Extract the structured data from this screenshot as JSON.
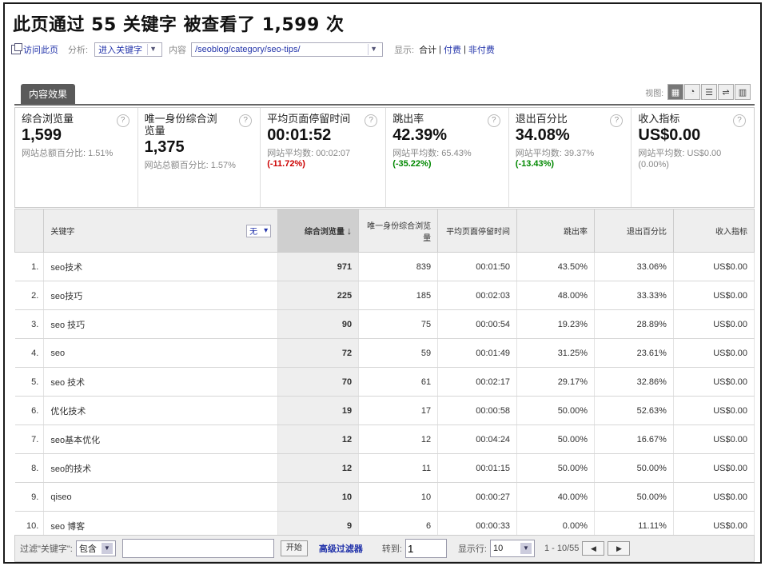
{
  "header": {
    "title": "此页通过 55 关键字 被查看了 1,599 次"
  },
  "toolbar": {
    "visit_page_label": "访问此页",
    "analysis_label": "分析:",
    "analysis_value": "进入关键字",
    "content_label": "内容",
    "content_value": "/seoblog/category/seo-tips/",
    "display_label": "显示:",
    "display_options": [
      "合计",
      "付费",
      "非付费"
    ]
  },
  "tab": {
    "label": "内容效果"
  },
  "views": {
    "label": "视图:",
    "icons": [
      "table-view-icon",
      "pie-view-icon",
      "bar-view-icon",
      "compare-view-icon",
      "pivot-view-icon"
    ]
  },
  "metrics": [
    {
      "label": "综合浏览量",
      "value": "1,599",
      "sub": "网站总额百分比: 1.51%",
      "change": ""
    },
    {
      "label": "唯一身份综合浏览量",
      "value": "1,375",
      "sub": "网站总额百分比: 1.57%",
      "change": ""
    },
    {
      "label": "平均页面停留时间",
      "value": "00:01:52",
      "sub": "网站平均数: 00:02:07",
      "change": "(-11.72%)",
      "change_type": "neg"
    },
    {
      "label": "跳出率",
      "value": "42.39%",
      "sub": "网站平均数: 65.43%",
      "change": "(-35.22%)",
      "change_type": "pos"
    },
    {
      "label": "退出百分比",
      "value": "34.08%",
      "sub": "网站平均数: 39.37%",
      "change": "(-13.43%)",
      "change_type": "pos"
    },
    {
      "label": "收入指标",
      "value": "US$0.00",
      "sub": "网站平均数: US$0.00 (0.00%)",
      "change": ""
    }
  ],
  "table": {
    "headers": {
      "keyword": "关键字",
      "keyword_filter": "无",
      "pageviews": "综合浏览量",
      "unique_pageviews": "唯一身份综合浏览量",
      "avg_time": "平均页面停留时间",
      "bounce_rate": "跳出率",
      "exit_pct": "退出百分比",
      "revenue": "收入指标"
    },
    "rows": [
      {
        "num": "1.",
        "keyword": "seo技术",
        "pageviews": "971",
        "unique": "839",
        "time": "00:01:50",
        "bounce": "43.50%",
        "exit": "33.06%",
        "revenue": "US$0.00"
      },
      {
        "num": "2.",
        "keyword": "seo技巧",
        "pageviews": "225",
        "unique": "185",
        "time": "00:02:03",
        "bounce": "48.00%",
        "exit": "33.33%",
        "revenue": "US$0.00"
      },
      {
        "num": "3.",
        "keyword": "seo 技巧",
        "pageviews": "90",
        "unique": "75",
        "time": "00:00:54",
        "bounce": "19.23%",
        "exit": "28.89%",
        "revenue": "US$0.00"
      },
      {
        "num": "4.",
        "keyword": "seo",
        "pageviews": "72",
        "unique": "59",
        "time": "00:01:49",
        "bounce": "31.25%",
        "exit": "23.61%",
        "revenue": "US$0.00"
      },
      {
        "num": "5.",
        "keyword": "seo 技术",
        "pageviews": "70",
        "unique": "61",
        "time": "00:02:17",
        "bounce": "29.17%",
        "exit": "32.86%",
        "revenue": "US$0.00"
      },
      {
        "num": "6.",
        "keyword": "优化技术",
        "pageviews": "19",
        "unique": "17",
        "time": "00:00:58",
        "bounce": "50.00%",
        "exit": "52.63%",
        "revenue": "US$0.00"
      },
      {
        "num": "7.",
        "keyword": "seo基本优化",
        "pageviews": "12",
        "unique": "12",
        "time": "00:04:24",
        "bounce": "50.00%",
        "exit": "16.67%",
        "revenue": "US$0.00"
      },
      {
        "num": "8.",
        "keyword": "seo的技术",
        "pageviews": "12",
        "unique": "11",
        "time": "00:01:15",
        "bounce": "50.00%",
        "exit": "50.00%",
        "revenue": "US$0.00"
      },
      {
        "num": "9.",
        "keyword": "qiseo",
        "pageviews": "10",
        "unique": "10",
        "time": "00:00:27",
        "bounce": "40.00%",
        "exit": "50.00%",
        "revenue": "US$0.00"
      },
      {
        "num": "10.",
        "keyword": "seo 博客",
        "pageviews": "9",
        "unique": "6",
        "time": "00:00:33",
        "bounce": "0.00%",
        "exit": "11.11%",
        "revenue": "US$0.00"
      }
    ]
  },
  "footer": {
    "filter_label": "过滤\"关键字\":",
    "filter_mode": "包含",
    "filter_value": "",
    "go_button": "开始",
    "advanced_filter": "高级过滤器",
    "goto_label": "转到:",
    "goto_value": "1",
    "rows_label": "显示行:",
    "rows_value": "10",
    "range": "1 - 10/55"
  }
}
